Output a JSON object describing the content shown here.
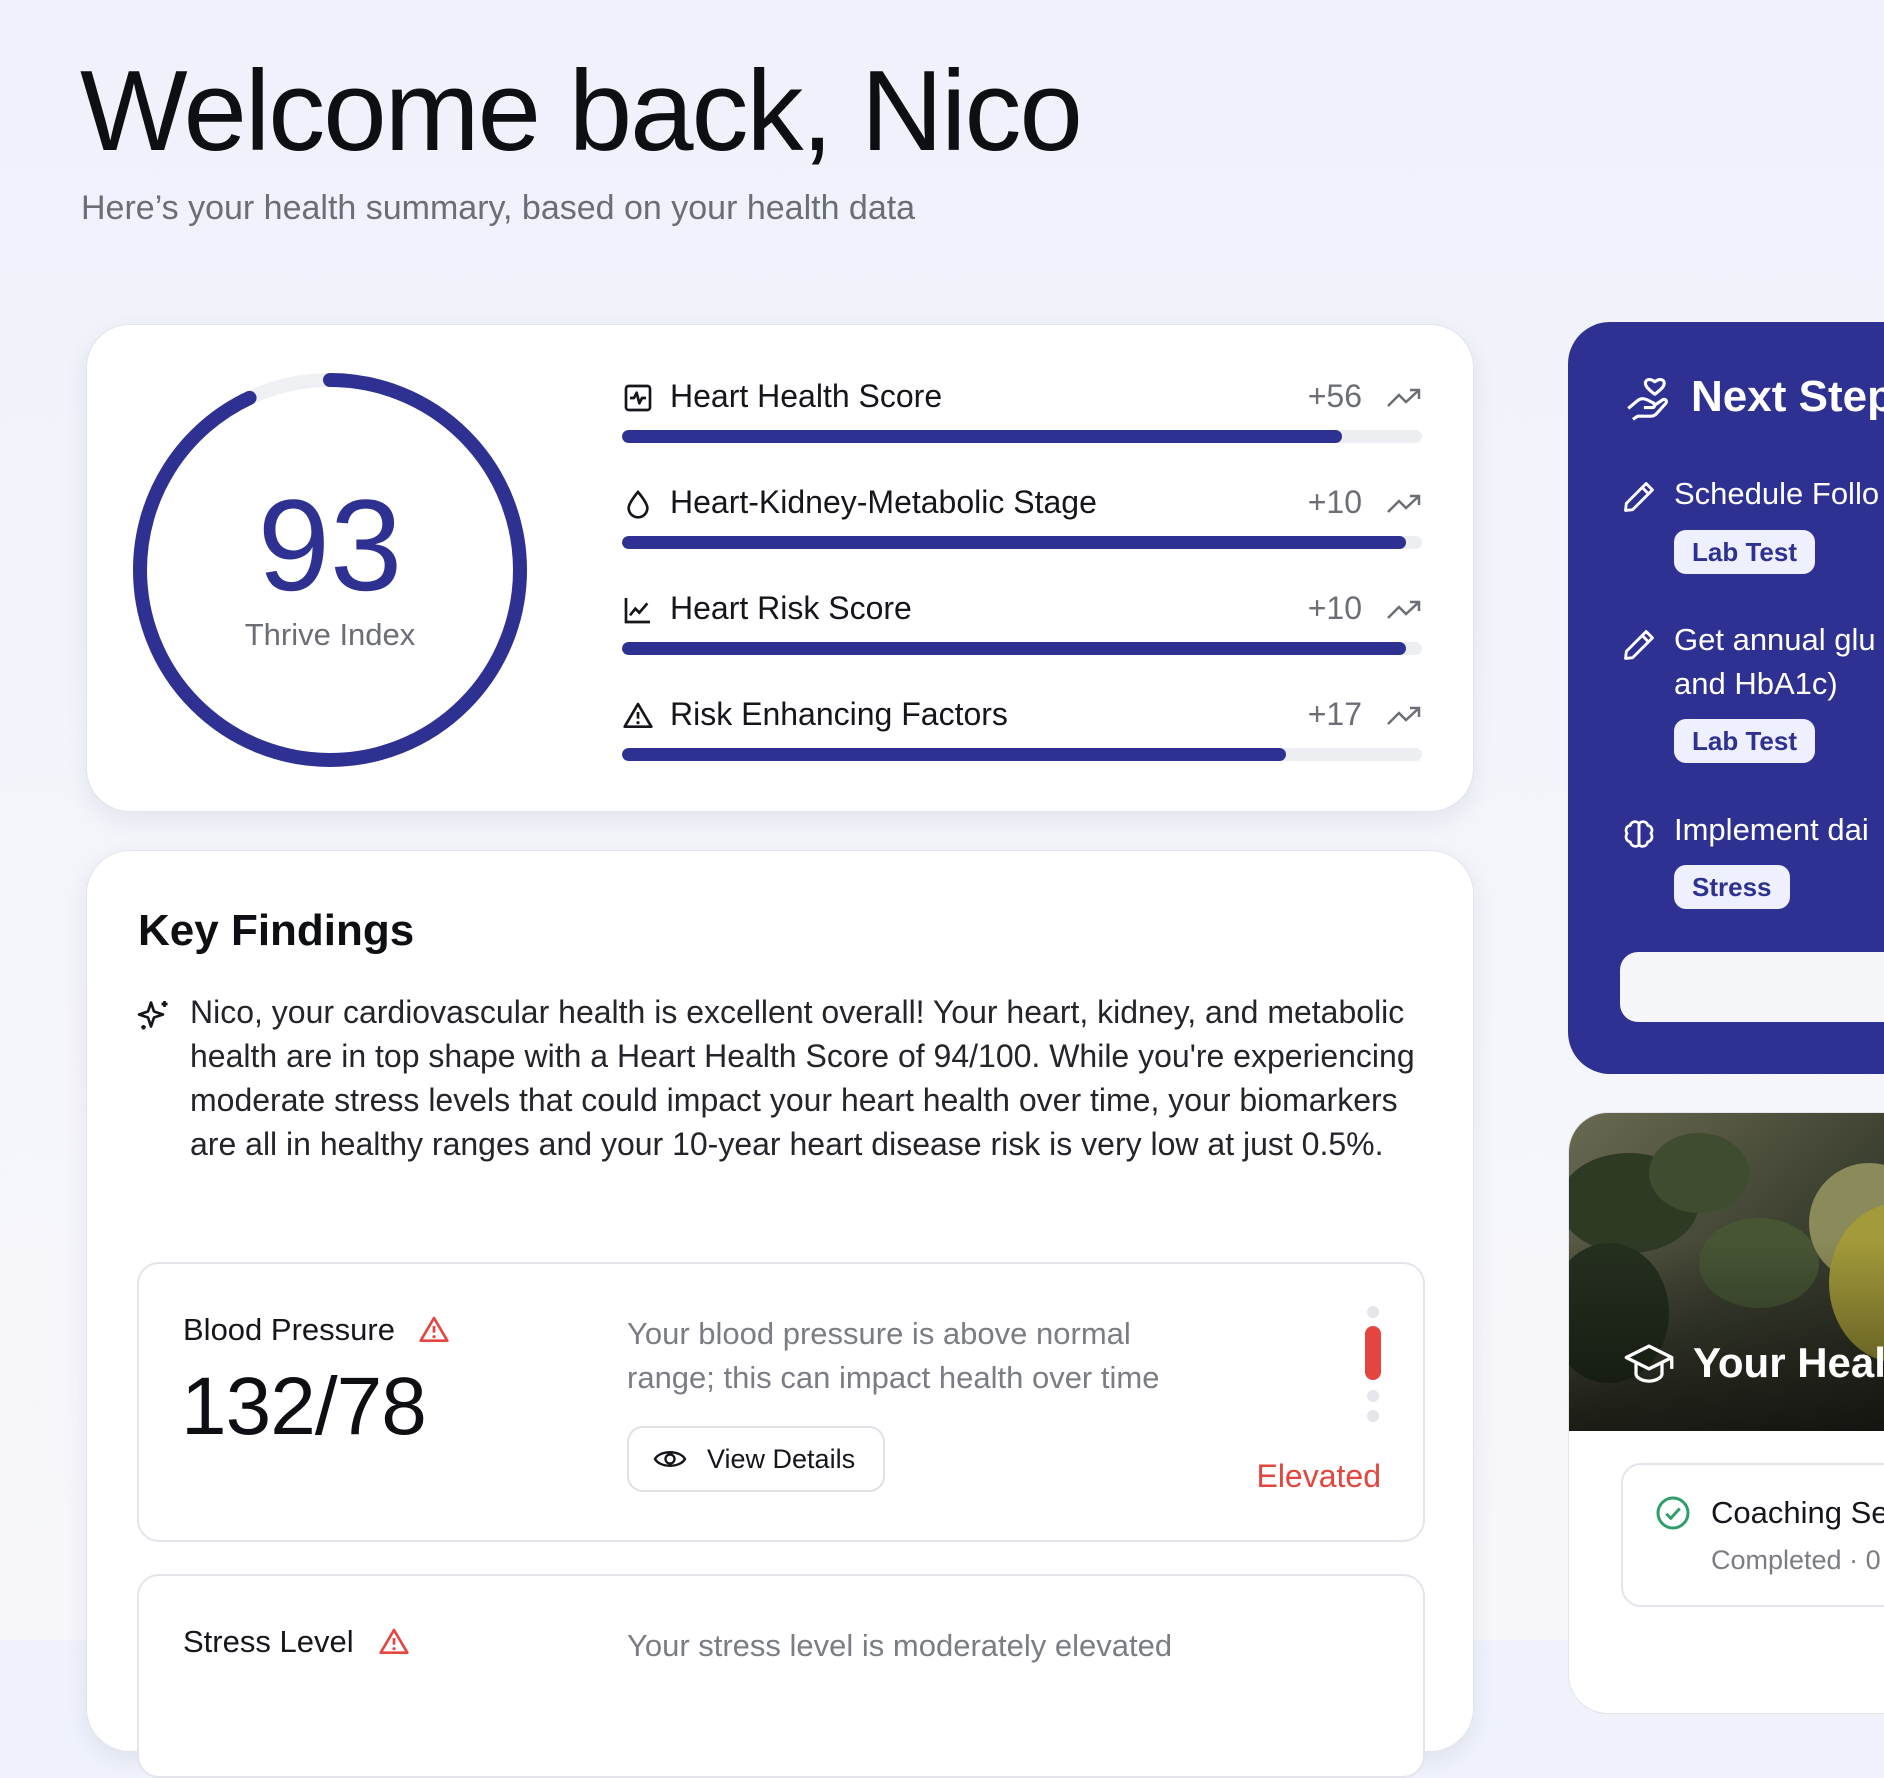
{
  "header": {
    "title": "Welcome back, Nico",
    "subtitle": "Here’s your health summary, based on your health data"
  },
  "thrive": {
    "score": "93",
    "label": "Thrive Index",
    "progress": 0.93
  },
  "metrics": [
    {
      "icon": "activity-square-icon",
      "name": "Heart Health Score",
      "delta": "+56",
      "progress": 0.9
    },
    {
      "icon": "droplet-icon",
      "name": "Heart-Kidney-Metabolic Stage",
      "delta": "+10",
      "progress": 0.98
    },
    {
      "icon": "line-chart-icon",
      "name": "Heart Risk Score",
      "delta": "+10",
      "progress": 0.98
    },
    {
      "icon": "warning-triangle-icon",
      "name": "Risk Enhancing Factors",
      "delta": "+17",
      "progress": 0.83
    }
  ],
  "findings": {
    "title": "Key Findings",
    "summary": "Nico, your cardiovascular health is excellent overall! Your heart, kidney, and metabolic health are in top shape with a Heart Health Score of 94/100. While you're experiencing moderate stress levels that could impact your heart health over time, your biomarkers are all in healthy ranges and your 10-year heart disease risk is very low at just 0.5%.",
    "items": [
      {
        "title": "Blood Pressure",
        "value": "132/78",
        "description": "Your blood pressure is above normal range; this can impact health over time",
        "button": "View Details",
        "status": "Elevated"
      },
      {
        "title": "Stress Level",
        "description": "Your stress level is moderately elevated"
      }
    ]
  },
  "next_steps": {
    "title": "Next Step",
    "steps": [
      {
        "icon": "pencil-icon",
        "lines": [
          "Schedule Follo"
        ],
        "tag": "Lab Test"
      },
      {
        "icon": "pencil-icon",
        "lines": [
          "Get annual glu",
          "and HbA1c)"
        ],
        "tag": "Lab Test"
      },
      {
        "icon": "brain-icon",
        "lines": [
          "Implement dai"
        ],
        "tag": "Stress"
      }
    ]
  },
  "course": {
    "title": "Your Healt",
    "item_title": "Coaching Se",
    "item_status": "Completed · 0"
  },
  "colors": {
    "accent": "#2e3191",
    "danger": "#e5453f",
    "success": "#2f9e6b"
  }
}
